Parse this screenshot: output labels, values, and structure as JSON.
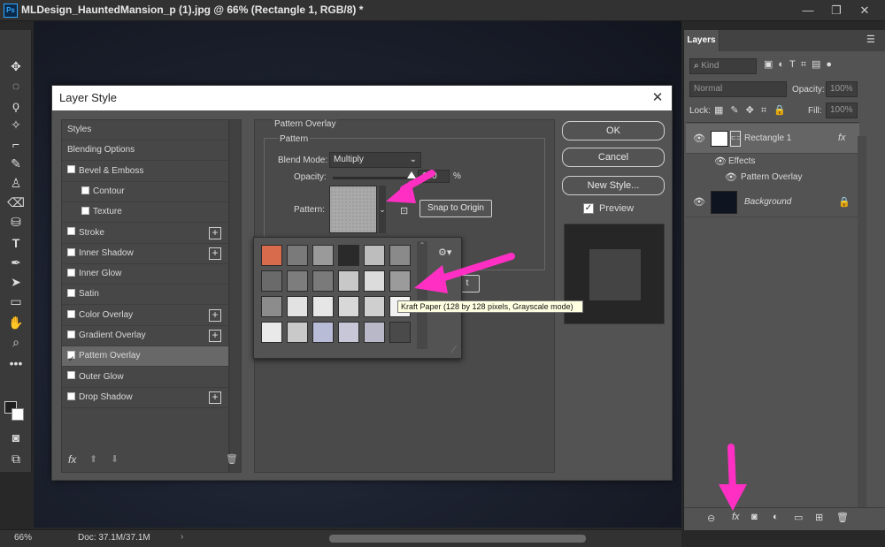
{
  "window": {
    "title": "MLDesign_HauntedMansion_p (1).jpg @ 66% (Rectangle 1, RGB/8) *",
    "app_badge": "Ps"
  },
  "statusbar": {
    "zoom": "66%",
    "doc": "Doc: 37.1M/37.1M"
  },
  "tools": [
    "move-tool",
    "marquee-tool",
    "lasso-tool",
    "magic-wand-tool",
    "eyedropper-tool",
    "brush-tool",
    "stamp-tool",
    "eraser-tool",
    "paint-bucket-tool",
    "text-tool",
    "pen-tool",
    "path-selection-tool",
    "rectangle-tool",
    "hand-tool",
    "zoom-tool",
    "more-tools"
  ],
  "dialog": {
    "title": "Layer Style",
    "styles": [
      {
        "label": "Styles",
        "checkbox": false,
        "plus": false,
        "indent": 0
      },
      {
        "label": "Blending Options",
        "checkbox": false,
        "plus": false,
        "indent": 0
      },
      {
        "label": "Bevel & Emboss",
        "checkbox": true,
        "checked": false,
        "plus": false,
        "indent": 0
      },
      {
        "label": "Contour",
        "checkbox": true,
        "checked": false,
        "plus": false,
        "indent": 1
      },
      {
        "label": "Texture",
        "checkbox": true,
        "checked": false,
        "plus": false,
        "indent": 1
      },
      {
        "label": "Stroke",
        "checkbox": true,
        "checked": false,
        "plus": true,
        "indent": 0
      },
      {
        "label": "Inner Shadow",
        "checkbox": true,
        "checked": false,
        "plus": true,
        "indent": 0
      },
      {
        "label": "Inner Glow",
        "checkbox": true,
        "checked": false,
        "plus": false,
        "indent": 0
      },
      {
        "label": "Satin",
        "checkbox": true,
        "checked": false,
        "plus": false,
        "indent": 0
      },
      {
        "label": "Color Overlay",
        "checkbox": true,
        "checked": false,
        "plus": true,
        "indent": 0
      },
      {
        "label": "Gradient Overlay",
        "checkbox": true,
        "checked": false,
        "plus": true,
        "indent": 0
      },
      {
        "label": "Pattern Overlay",
        "checkbox": true,
        "checked": true,
        "plus": false,
        "indent": 0,
        "selected": true
      },
      {
        "label": "Outer Glow",
        "checkbox": true,
        "checked": false,
        "plus": false,
        "indent": 0
      },
      {
        "label": "Drop Shadow",
        "checkbox": true,
        "checked": false,
        "plus": true,
        "indent": 0
      }
    ],
    "section_title": "Pattern Overlay",
    "group_title": "Pattern",
    "blend_mode_label": "Blend Mode:",
    "blend_mode_value": "Multiply",
    "opacity_label": "Opacity:",
    "opacity_value": "100",
    "opacity_unit": "%",
    "opacity_level": 1.0,
    "pattern_label": "Pattern:",
    "snap_button": "Snap to Origin",
    "hidden_button_fragment": "t",
    "ok": "OK",
    "cancel": "Cancel",
    "new_style": "New Style...",
    "preview_label": "Preview",
    "preview_checked": true,
    "footer_fx": "fx",
    "tooltip": "Kraft Paper (128 by 128 pixels, Grayscale mode)"
  },
  "swatches": [
    [
      "#d86b4c",
      "#7a7a7a",
      "#9a9a9a",
      "#2a2a2a",
      "#bdbdbd",
      "#8a8a8a"
    ],
    [
      "#6a6a6a",
      "#7d7d7d",
      "#7a7a7a",
      "#c8c8c8",
      "#dcdcdc",
      "#9b9b9b"
    ],
    [
      "#8c8c8c",
      "#e2e2e2",
      "#e6e6e6",
      "#d8d8d8",
      "#cfcfcf",
      "#f2f2f2"
    ],
    [
      "#e9e9e9",
      "#c9c9c9",
      "#b9bcd6",
      "#c7c7d8",
      "#b8b8c8",
      "#4a4a4a"
    ]
  ],
  "layers_panel": {
    "tab": "Layers",
    "kind_placeholder": "Kind",
    "blend": "Normal",
    "opacity_label": "Opacity:",
    "opacity_value": "100%",
    "lock_label": "Lock:",
    "fill_label": "Fill:",
    "fill_value": "100%",
    "layer1": "Rectangle 1",
    "layer1_fx": "fx",
    "effects": "Effects",
    "effect1": "Pattern Overlay",
    "layer2": "Background"
  },
  "colors": {
    "accent_arrow": "#ff2fc4",
    "dialog_bg": "#535353",
    "selected_row": "#686868"
  }
}
